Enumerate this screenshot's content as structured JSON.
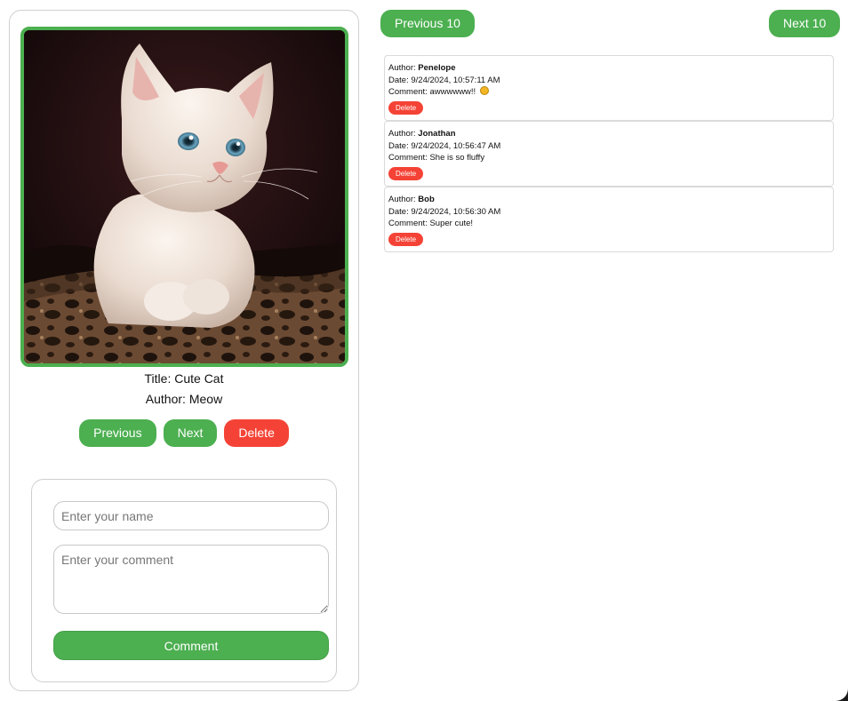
{
  "viewer": {
    "title_label": "Title:",
    "title_value": "Cute Cat",
    "author_label": "Author:",
    "author_value": "Meow",
    "previous_label": "Previous",
    "next_label": "Next",
    "delete_label": "Delete"
  },
  "comment_form": {
    "name_placeholder": "Enter your name",
    "comment_placeholder": "Enter your comment",
    "submit_label": "Comment"
  },
  "pager": {
    "previous_label": "Previous 10",
    "next_label": "Next 10"
  },
  "comments": [
    {
      "author_label": "Author:",
      "author": "Penelope",
      "date_label": "Date:",
      "date": "9/24/2024, 10:57:11 AM",
      "comment_label": "Comment:",
      "text": "awwwwww!!",
      "emoji": "smiling-face-icon",
      "delete_label": "Delete"
    },
    {
      "author_label": "Author:",
      "author": "Jonathan",
      "date_label": "Date:",
      "date": "9/24/2024, 10:56:47 AM",
      "comment_label": "Comment:",
      "text": "She is so fluffy",
      "delete_label": "Delete"
    },
    {
      "author_label": "Author:",
      "author": "Bob",
      "date_label": "Date:",
      "date": "9/24/2024, 10:56:30 AM",
      "comment_label": "Comment:",
      "text": "Super cute!",
      "delete_label": "Delete"
    }
  ],
  "colors": {
    "primary_green": "#4caf50",
    "danger_red": "#f44336",
    "photo_border": "#4caf50"
  }
}
